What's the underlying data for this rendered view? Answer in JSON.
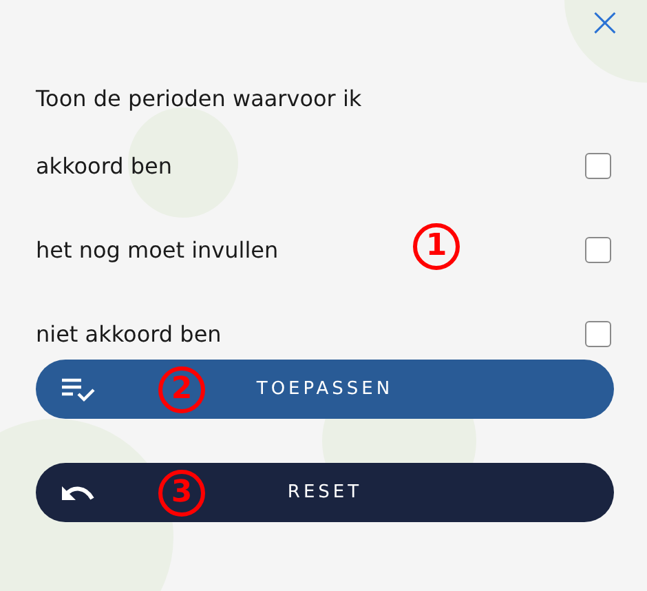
{
  "close": {
    "label": "×"
  },
  "heading": "Toon de perioden waarvoor ik",
  "options": [
    {
      "label": "akkoord ben",
      "checked": false
    },
    {
      "label": "het nog moet invullen",
      "checked": false,
      "callout": "1"
    },
    {
      "label": "niet akkoord ben",
      "checked": false
    }
  ],
  "buttons": [
    {
      "kind": "apply",
      "label": "TOEPASSEN",
      "callout": "2"
    },
    {
      "kind": "reset",
      "label": "RESET",
      "callout": "3"
    }
  ]
}
